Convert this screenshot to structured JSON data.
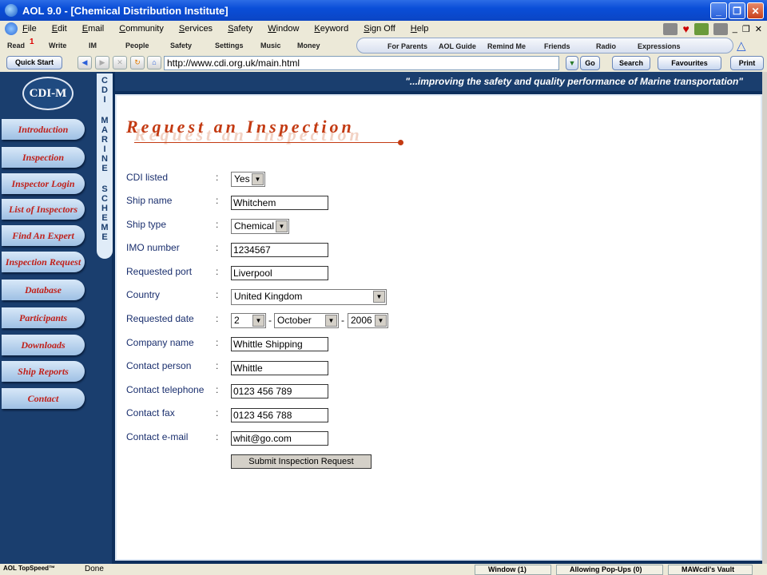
{
  "window": {
    "title": "AOL 9.0 - [Chemical Distribution Institute]"
  },
  "menu": [
    "File",
    "Edit",
    "Email",
    "Community",
    "Services",
    "Safety",
    "Window",
    "Keyword",
    "Sign Off",
    "Help"
  ],
  "toolbar": {
    "read": "Read",
    "read_badge": "1",
    "write": "Write",
    "im": "IM",
    "people": "People",
    "safety": "Safety",
    "settings": "Settings",
    "music": "Music",
    "money": "Money"
  },
  "channels": [
    "For Parents",
    "AOL Guide",
    "Remind Me",
    "Friends",
    "Radio",
    "Expressions"
  ],
  "nav": {
    "quick_start": "Quick Start",
    "url": "http://www.cdi.org.uk/main.html",
    "go": "Go",
    "search": "Search",
    "favourites": "Favourites",
    "print": "Print"
  },
  "site": {
    "logo": "CDI-M",
    "vertical": [
      "C",
      "D",
      "I",
      "",
      "M",
      "A",
      "R",
      "I",
      "N",
      "E",
      "",
      "S",
      "C",
      "H",
      "E",
      "M",
      "E"
    ],
    "tagline": "\"...improving the safety and quality performance of Marine transportation\"",
    "nav_items": [
      "Introduction",
      "Inspection",
      "Inspector Login",
      "List of Inspectors",
      "Find An Expert",
      "Inspection Request",
      "Database",
      "Participants",
      "Downloads",
      "Ship Reports",
      "Contact"
    ]
  },
  "form": {
    "heading": "Request an Inspection",
    "cdi_listed": {
      "label": "CDI listed",
      "value": "Yes"
    },
    "ship_name": {
      "label": "Ship name",
      "value": "Whitchem"
    },
    "ship_type": {
      "label": "Ship type",
      "value": "Chemical"
    },
    "imo": {
      "label": "IMO number",
      "value": "1234567"
    },
    "port": {
      "label": "Requested port",
      "value": "Liverpool"
    },
    "country": {
      "label": "Country",
      "value": "United Kingdom"
    },
    "date": {
      "label": "Requested date",
      "day": "2",
      "month": "October",
      "year": "2006"
    },
    "company": {
      "label": "Company name",
      "value": "Whittle Shipping"
    },
    "contact": {
      "label": "Contact person",
      "value": "Whittle"
    },
    "phone": {
      "label": "Contact telephone",
      "value": "0123 456 789"
    },
    "fax": {
      "label": "Contact fax",
      "value": "0123 456 788"
    },
    "email": {
      "label": "Contact e-mail",
      "value": "whit@go.com"
    },
    "submit": "Submit Inspection Request",
    "colon": ":",
    "dash": "-"
  },
  "status": {
    "brand": "AOL TopSpeed™",
    "text": "Done",
    "window": "Window (1)",
    "popups": "Allowing Pop-Ups (0)",
    "vault": "MAWcdi's Vault"
  }
}
